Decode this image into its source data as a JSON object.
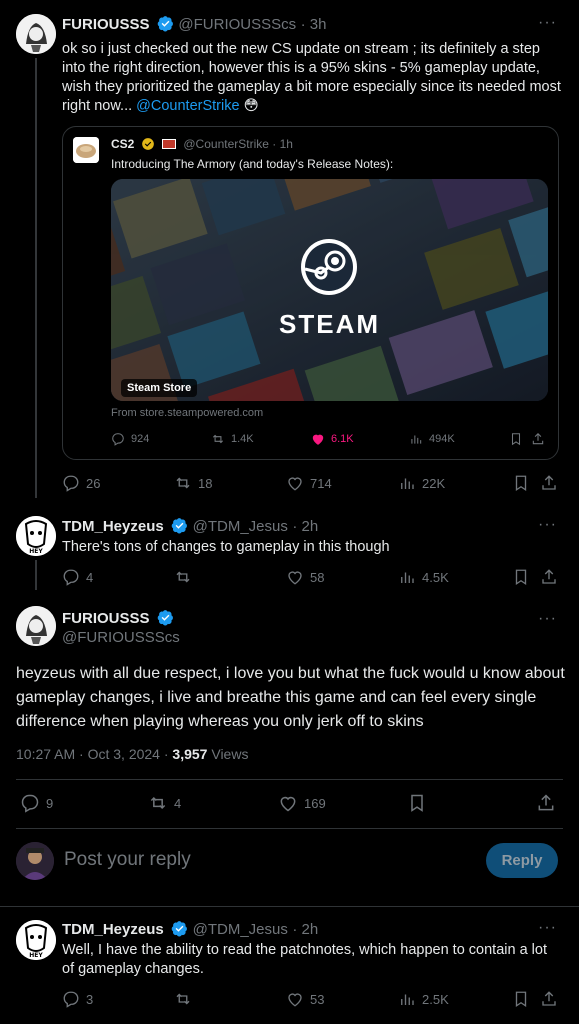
{
  "tweet1": {
    "name": "FURIOUSSS",
    "handle": "@FURIOUSSScs",
    "time": "· 3h",
    "text": "ok so i just checked out the new CS update on stream ; its definitely a step into the right direction, however this is a 95% skins - 5% gameplay update, wish they prioritized the gameplay a bit more especially since its needed most right now...",
    "mention": "@CounterStrike",
    "emoji": "😳",
    "stats": {
      "replies": "26",
      "reposts": "18",
      "likes": "714",
      "views": "22K"
    }
  },
  "quote": {
    "name": "CS2",
    "handle": "@CounterStrike · 1h",
    "text": "Introducing The Armory (and today's Release Notes):",
    "card_label": "Steam Store",
    "card_brand": "STEAM",
    "card_source": "From store.steampowered.com",
    "stats": {
      "replies": "924",
      "reposts": "1.4K",
      "likes": "6.1K",
      "views": "494K"
    }
  },
  "tweet2": {
    "name": "TDM_Heyzeus",
    "handle": "@TDM_Jesus",
    "time": "· 2h",
    "text": "There's tons of changes to gameplay in this though",
    "stats": {
      "replies": "4",
      "reposts": "",
      "likes": "58",
      "views": "4.5K"
    }
  },
  "main": {
    "name": "FURIOUSSS",
    "handle": "@FURIOUSSScs",
    "text": "heyzeus with all due respect, i love you but what the fuck would u know about gameplay changes, i live and breathe this game and can feel every single difference when playing whereas you only jerk off to skins",
    "time": "10:27 AM · Oct 3, 2024 · ",
    "views_count": "3,957",
    "views_label": " Views",
    "stats": {
      "replies": "9",
      "reposts": "4",
      "likes": "169"
    }
  },
  "reply_box": {
    "placeholder": "Post your reply",
    "button": "Reply"
  },
  "tweet3": {
    "name": "TDM_Heyzeus",
    "handle": "@TDM_Jesus",
    "time": "· 2h",
    "text": "Well, I have the ability to read the patchnotes, which happen to contain a lot of gameplay changes.",
    "stats": {
      "replies": "3",
      "reposts": "",
      "likes": "53",
      "views": "2.5K"
    }
  },
  "colors": {
    "accent": "#1d9bf0",
    "like_active": "#f91880",
    "muted": "#71767b"
  }
}
